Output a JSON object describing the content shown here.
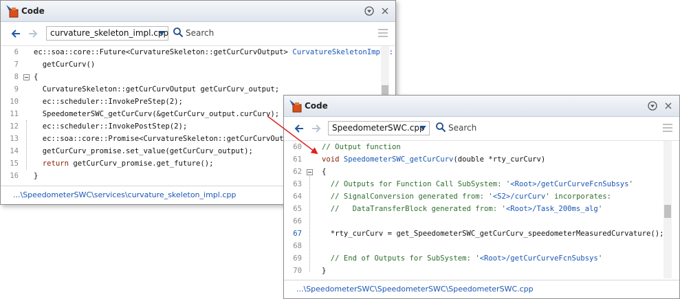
{
  "window1": {
    "title": "Code",
    "file": "curvature_skeleton_impl.cpp",
    "search_placeholder": "Search",
    "footer_path": "...\\SpeedometerSWC\\services\\curvature_skeleton_impl.cpp",
    "lines": [
      {
        "n": "6",
        "t": "ec::soa::core::Future<CurvatureSkeleton::getCurCurvOutput> ",
        "t2": "CurvatureSkeletonImpl::"
      },
      {
        "n": "7",
        "t": "  getCurCurv()"
      },
      {
        "n": "8",
        "t": "{"
      },
      {
        "n": "9",
        "t": "  CurvatureSkeleton::getCurCurvOutput getCurCurv_output;"
      },
      {
        "n": "10",
        "t": "  ec::scheduler::InvokePreStep(2);"
      },
      {
        "n": "11",
        "t": "  SpeedometerSWC_getCurCurv(&getCurCurv_output.curCurv);"
      },
      {
        "n": "12",
        "t": "  ec::scheduler::InvokePostStep(2);"
      },
      {
        "n": "13",
        "t": "  ec::soa::core::Promise<CurvatureSkeleton::getCurCurvOutput"
      },
      {
        "n": "14",
        "t": "  getCurCurv_promise.set_value(getCurCurv_output);"
      },
      {
        "n": "15",
        "kw": "  return",
        "t": " getCurCurv_promise.get_future();"
      },
      {
        "n": "16",
        "t": "}"
      }
    ]
  },
  "window2": {
    "title": "Code",
    "file": "SpeedometerSWC.cpp",
    "search_placeholder": "Search",
    "footer_path": "...\\SpeedometerSWC\\SpeedometerSWC\\SpeedometerSWC.cpp",
    "lines": [
      {
        "n": "60",
        "cm": "// Output function"
      },
      {
        "n": "61",
        "kw": "void",
        "lk": " SpeedometerSWC_getCurCurv",
        "t": "(double *rty_curCurv)"
      },
      {
        "n": "62",
        "t": "{"
      },
      {
        "n": "63",
        "cm": "  // Outputs for Function Call SubSystem: '",
        "lk": "<Root>/getCurCurveFcnSubsys",
        "cm2": "'"
      },
      {
        "n": "64",
        "cm": "  // SignalConversion generated from: '",
        "lk": "<S2>/curCurv",
        "cm2": "' incorporates:"
      },
      {
        "n": "65",
        "cm": "  //   DataTransferBlock generated from: '",
        "lk": "<Root>/Task_200ms_alg",
        "cm2": "'"
      },
      {
        "n": "66",
        "t": ""
      },
      {
        "n": "67",
        "t": "  *rty_curCurv = get_SpeedometerSWC_getCurCurv_speedometerMeasuredCurvature();"
      },
      {
        "n": "68",
        "t": ""
      },
      {
        "n": "69",
        "cm": "  // End of Outputs for SubSystem: '",
        "lk": "<Root>/getCurCurveFcnSubsys",
        "cm2": "'"
      },
      {
        "n": "70",
        "t": "}"
      }
    ]
  },
  "colors": {
    "arrow": "#e02020",
    "link": "#1a56b5",
    "keyword": "#8b1c00",
    "comment": "#2d6e2d"
  }
}
